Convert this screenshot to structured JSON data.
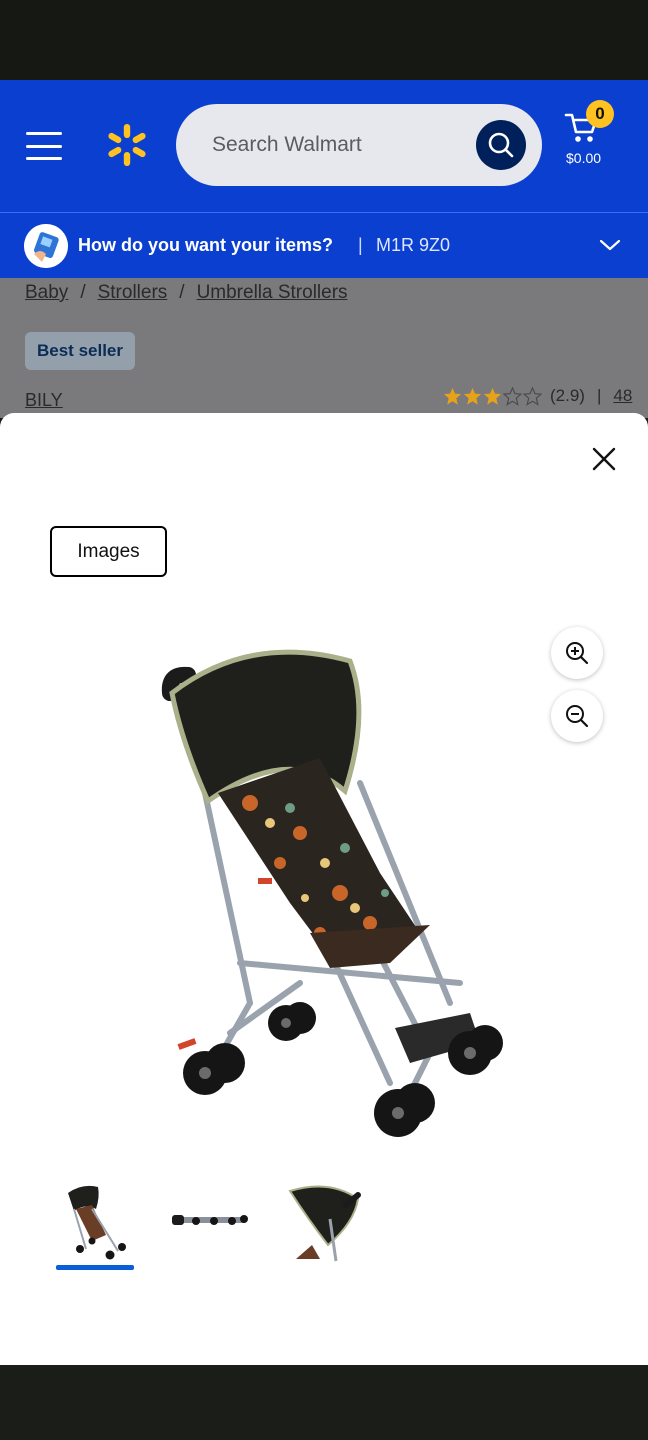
{
  "header": {
    "search_placeholder": "Search Walmart",
    "cart_count": "0",
    "cart_total": "$0.00"
  },
  "delivery": {
    "question": "How do you want your items?",
    "separator": "|",
    "postal_code": "M1R 9Z0"
  },
  "breadcrumb": {
    "items": [
      "Baby",
      "Strollers",
      "Umbrella Strollers"
    ],
    "separator": "/"
  },
  "product": {
    "badge": "Best seller",
    "brand": "BILY",
    "rating_text": "(2.9)",
    "rating_value": 2.9,
    "rating_max": 5,
    "separator": "|",
    "review_count": "48"
  },
  "modal": {
    "tab_label": "Images",
    "thumbnail_count": 3,
    "selected_thumbnail": 1
  },
  "colors": {
    "brand_blue": "#0a3fd0",
    "spark_yellow": "#ffc220",
    "search_button": "#00205b",
    "thumb_underline": "#0a5ed7",
    "star_gold": "#e6a31a"
  },
  "icons": [
    "menu-icon",
    "walmart-spark-icon",
    "search-icon",
    "cart-icon",
    "delivery-icon",
    "chevron-down-icon",
    "close-icon",
    "zoom-in-icon",
    "zoom-out-icon"
  ]
}
